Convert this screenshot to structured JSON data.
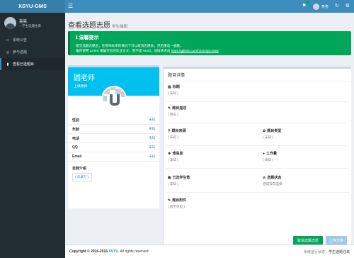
{
  "header": {
    "logo": "XSYU-GMS",
    "menu_icon": "menu-icon",
    "user_name": "亮亮",
    "icons": [
      "flag-icon",
      "user-avatar",
      "refresh-icon",
      "gear-icon"
    ]
  },
  "sidebar": {
    "user_name": "亮亮",
    "user_status": "学生选题往来",
    "items": [
      {
        "icon": "desktop-icon",
        "label": "系统公告",
        "active": false
      },
      {
        "icon": "globe-icon",
        "label": "参与选题",
        "active": false
      },
      {
        "icon": "bookmark-icon",
        "label": "查看已选题目",
        "active": true
      }
    ]
  },
  "page": {
    "title": "查看选题志愿",
    "subtitle": "学生端面",
    "breadcrumb": ""
  },
  "callout": {
    "title": "温馨提示",
    "line1": "提交选题志愿后，在教师未审的情况下可以取消志愿表，然后重选一遍题。",
    "line2": "推荐使用 LaTeX 来编写您的毕业论文，而不是 Word，详情请点击",
    "link": "https://github.com/h2u/xsyu-latex"
  },
  "profile": {
    "name": "圆老师",
    "role": "上课教师",
    "rows": [
      {
        "key": "性别",
        "value": "未知"
      },
      {
        "key": "年龄",
        "value": "未知"
      },
      {
        "key": "电话",
        "value": "未知"
      },
      {
        "key": "QQ",
        "value": "未知"
      },
      {
        "key": "Email",
        "value": "未知"
      }
    ],
    "intro_label": "自我介绍",
    "intro_value": "( 未填写 )"
  },
  "detail": {
    "title": "题目详情",
    "topic_label": "标题",
    "topic_value": "( 未知 )",
    "desc_label": "题目描述",
    "desc_value": "( 空白 )",
    "source_label": "题目来源",
    "source_value": "( 未知 )",
    "type_label": "题目类型",
    "type_value": "( 未知 )",
    "difficulty_label": "难易度",
    "difficulty_value": "( 未知 )",
    "workload_label": "工作量",
    "workload_value": "( 未知 )",
    "selected_label": "已选学生数",
    "selected_value": "( 未知 )",
    "status_label": "选题状态",
    "status_value": "完成双向选择",
    "attach_label": "题目附件",
    "attach_value": "( 暂不可见 )",
    "cancel_button": "取消选题志愿",
    "submit_button": "上传文档"
  },
  "footer": {
    "copyright": "Copyright © 2016-2016",
    "brand": "XSYU.",
    "rights": "All rights reserved.",
    "right_label": "系统运行状态：",
    "right_value": "学生选题往来"
  },
  "colors": {
    "header": "#3c8dbc",
    "logo_bg": "#367fa9",
    "sidebar": "#222d32",
    "callout": "#00a65a",
    "profile_head": "#00c0ef"
  }
}
